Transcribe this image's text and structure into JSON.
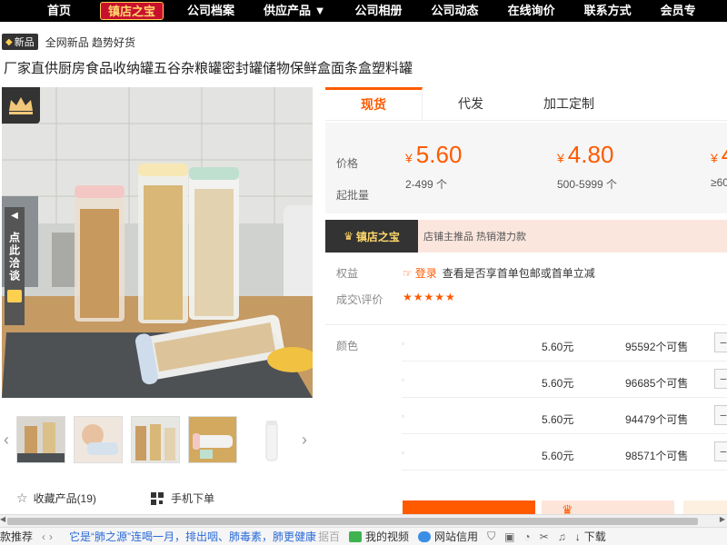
{
  "nav": {
    "items": [
      "首页",
      "镇店之宝",
      "公司档案",
      "供应产品 ▼",
      "公司相册",
      "公司动态",
      "在线询价",
      "联系方式",
      "会员专"
    ]
  },
  "badge": {
    "label": "新品",
    "text": "全网新品 趋势好货"
  },
  "product": {
    "title": "厂家直供厨房食品收纳罐五谷杂粮罐密封罐储物保鲜盒面条盒塑料罐"
  },
  "side_tab": {
    "text": "点此洽谈"
  },
  "tabs": [
    "现货",
    "代发",
    "加工定制"
  ],
  "price": {
    "label": "价格",
    "moq_label": "起批量",
    "currency": "¥",
    "tiers": [
      {
        "price": "5.60",
        "range": "2-499 个"
      },
      {
        "price": "4.80",
        "range": "500-5999 个"
      },
      {
        "price": "4",
        "range": "≥60"
      }
    ]
  },
  "shop_banner": {
    "badge": "镇店之宝",
    "text": "店铺主推品  热销潜力款"
  },
  "benefits": {
    "label": "权益",
    "login": "登录",
    "text": "查看是否享首单包邮或首单立减"
  },
  "review": {
    "label": "成交\\评价",
    "stars": "★★★★★"
  },
  "sku": {
    "label": "颜色",
    "rows": [
      {
        "price": "5.60元",
        "stock": "95592个可售"
      },
      {
        "price": "5.60元",
        "stock": "96685个可售"
      },
      {
        "price": "5.60元",
        "stock": "94479个可售"
      },
      {
        "price": "5.60元",
        "stock": "98571个可售"
      }
    ]
  },
  "actions": {
    "favorite": "收藏产品(19)",
    "mobile": "手机下单"
  },
  "statusbar": {
    "left": "款推荐",
    "news": "它是“肺之源”连喝一月，排出咽、肺毒素，肺更健康",
    "news_tail": "据百",
    "video": "我的视频",
    "site": "网站信用",
    "download": "下载"
  },
  "colors": {
    "accent": "#ff5a00",
    "nav_bg": "#000000",
    "brand_red": "#c8102e",
    "gold": "#ffcf50"
  }
}
